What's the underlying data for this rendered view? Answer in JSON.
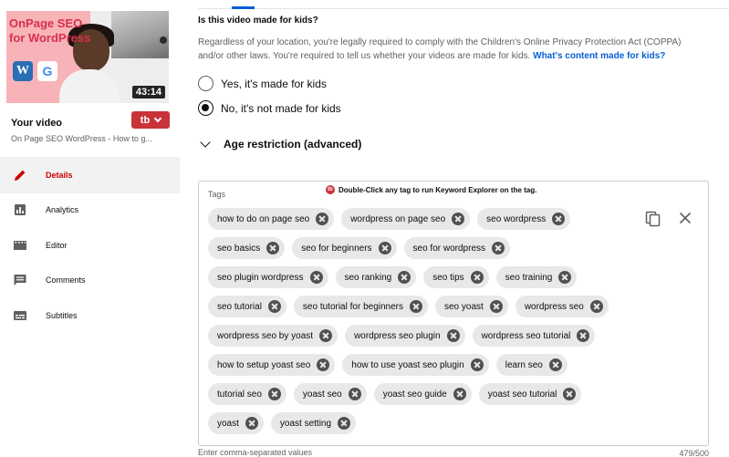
{
  "sidebar": {
    "thumbnail": {
      "title_text": "OnPage SEO for WordPress",
      "logo_wordpress": "W",
      "logo_google": "G",
      "duration": "43:14"
    },
    "your_video_label": "Your video",
    "video_subtitle": "On Page SEO WordPress - How to g...",
    "tubebuddy_button_label": "tb",
    "nav": [
      {
        "label": "Details",
        "icon": "pencil-icon",
        "active": true
      },
      {
        "label": "Analytics",
        "icon": "analytics-icon",
        "active": false
      },
      {
        "label": "Editor",
        "icon": "film-icon",
        "active": false
      },
      {
        "label": "Comments",
        "icon": "comment-icon",
        "active": false
      },
      {
        "label": "Subtitles",
        "icon": "subtitles-icon",
        "active": false
      }
    ]
  },
  "kids": {
    "heading": "Is this video made for kids?",
    "description": "Regardless of your location, you're legally required to comply with the Children's Online Privacy Protection Act (COPPA) and/or other laws. You're required to tell us whether your videos are made for kids.",
    "link": "What's content made for kids?",
    "options": [
      {
        "label": "Yes, it's made for kids",
        "checked": false
      },
      {
        "label": "No, it's not made for kids",
        "checked": true
      }
    ]
  },
  "age_restriction": {
    "label": "Age restriction (advanced)"
  },
  "tags": {
    "label": "Tags",
    "hint": "Double-Click any tag to run Keyword Explorer on the tag.",
    "hint_icon_text": "tb",
    "rows": [
      [
        "how to do on page seo",
        "wordpress on page seo",
        "seo wordpress"
      ],
      [
        "seo basics",
        "seo for beginners",
        "seo for wordpress"
      ],
      [
        "seo plugin wordpress",
        "seo ranking",
        "seo tips",
        "seo training"
      ],
      [
        "seo tutorial",
        "seo tutorial for beginners",
        "seo yoast",
        "wordpress seo"
      ],
      [
        "wordpress seo by yoast",
        "wordpress seo plugin",
        "wordpress seo tutorial"
      ],
      [
        "how to setup yoast seo",
        "how to use yoast seo plugin",
        "learn seo"
      ],
      [
        "tutorial seo",
        "yoast seo",
        "yoast seo guide",
        "yoast seo tutorial"
      ],
      [
        "yoast",
        "yoast setting"
      ]
    ],
    "helper_text": "Enter comma-separated values",
    "char_count": "479/500"
  },
  "colors": {
    "accent_blue": "#065fd4",
    "active_red": "#cc0000",
    "tubebuddy_red": "#c83238",
    "chip_bg": "#e8e8e8"
  }
}
